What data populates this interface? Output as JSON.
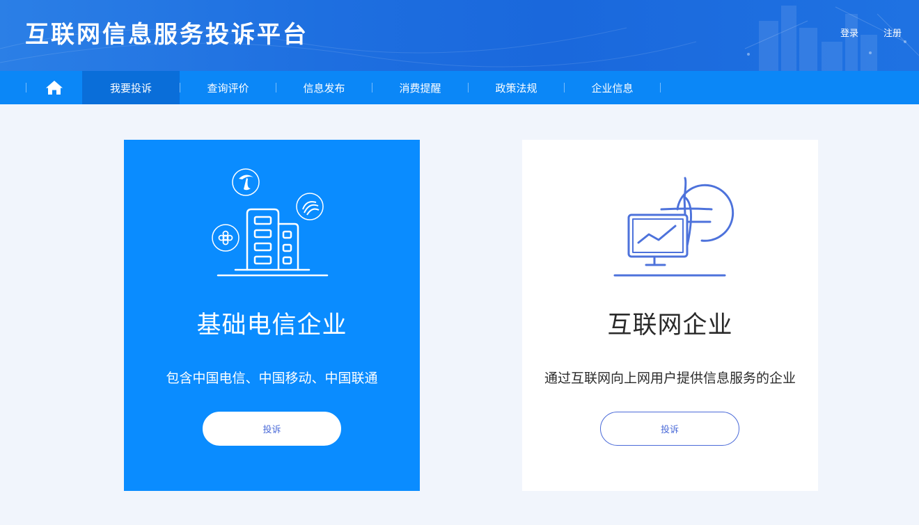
{
  "header": {
    "title": "互联网信息服务投诉平台",
    "login_label": "登录",
    "register_label": "注册"
  },
  "nav": {
    "home_icon": "home-icon",
    "items": [
      {
        "label": "我要投诉",
        "active": true
      },
      {
        "label": "查询评价",
        "active": false
      },
      {
        "label": "信息发布",
        "active": false
      },
      {
        "label": "消费提醒",
        "active": false
      },
      {
        "label": "政策法规",
        "active": false
      },
      {
        "label": "企业信息",
        "active": false
      }
    ]
  },
  "cards": [
    {
      "title": "基础电信企业",
      "description": "包含中国电信、中国移动、中国联通",
      "button_label": "投诉",
      "icon": "telecom-buildings-icon",
      "background": "#0a8cff"
    },
    {
      "title": "互联网企业",
      "description": "通过互联网向上网用户提供信息服务的企业",
      "button_label": "投诉",
      "icon": "monitor-globe-icon",
      "background": "#ffffff"
    }
  ],
  "colors": {
    "header": "#1e6fe0",
    "nav": "#0b87f7",
    "nav_active": "#0a6ed9",
    "accent": "#4a6ad8",
    "page_bg": "#f1f5fc"
  }
}
